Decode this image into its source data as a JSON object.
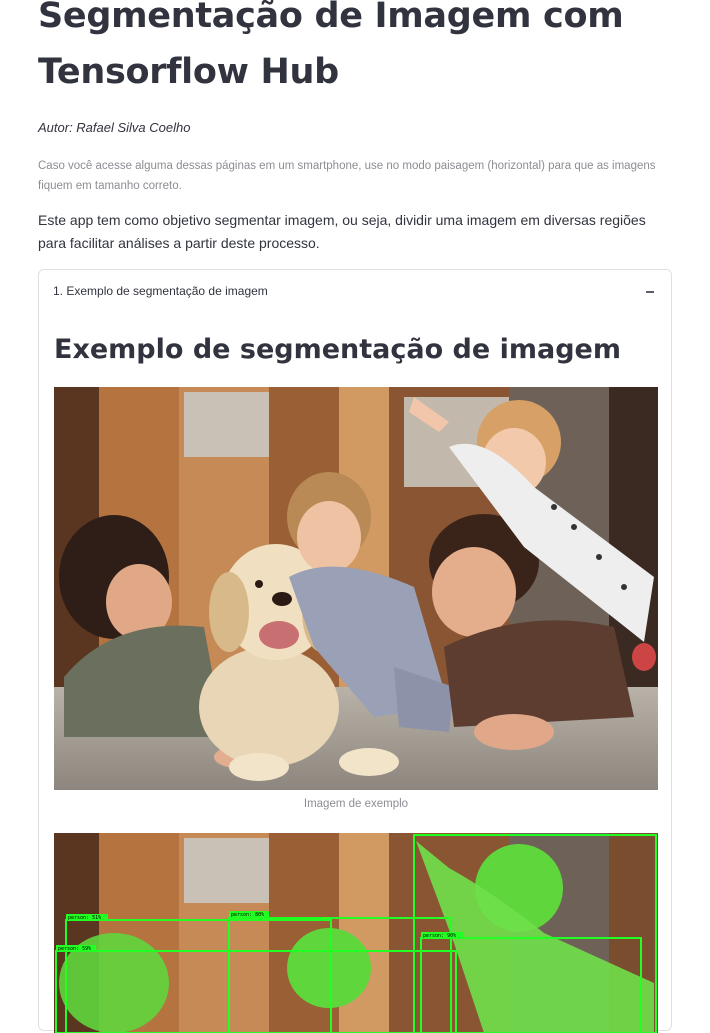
{
  "page": {
    "title": "Segmentação de Imagem com Tensorflow Hub",
    "author": "Autor: Rafael Silva Coelho",
    "mobile_note": "Caso você acesse alguma dessas páginas em um smartphone, use no modo paisagem (horizontal) para que as imagens fiquem em tamanho correto.",
    "description": "Este app tem como objetivo segmentar imagem, ou seja, dividir uma imagem em diversas regiões para facilitar análises a partir deste processo."
  },
  "expander": {
    "label": "1. Exemplo de segmentação de imagem",
    "state_icon": "minus-icon",
    "section_title": "Exemplo de segmentação de imagem",
    "image_caption": "Imagem de exemplo"
  },
  "detections": {
    "labels": [
      "person: 51%",
      "person: 80%",
      "person: 90%",
      "person: 59%"
    ]
  },
  "colors": {
    "text": "#31333f",
    "muted": "#8c8d94",
    "border": "#dfe0e4",
    "detection_box": "#22ff22"
  }
}
